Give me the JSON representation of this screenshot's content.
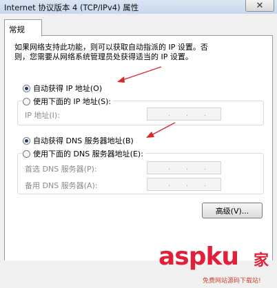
{
  "window": {
    "title": "Internet 协议版本 4 (TCP/IPv4) 属性"
  },
  "tabs": [
    {
      "label": "常规"
    }
  ],
  "description": {
    "line1": "如果网络支持此功能，则可以获取自动指派的 IP 设置。否",
    "line2": "则，您需要从网络系统管理员处获得适当的 IP 设置。"
  },
  "ip": {
    "auto_label": "自动获得 IP 地址(O)",
    "manual_label": "使用下面的 IP 地址(S):",
    "address_label": "IP 地址(I):"
  },
  "dns": {
    "auto_label": "自动获得 DNS 服务器地址(B)",
    "manual_label": "使用下面的 DNS 服务器地址(E):",
    "preferred_label": "首选 DNS 服务器(P):",
    "alternate_label": "备用 DNS 服务器(A):"
  },
  "buttons": {
    "advanced_label": "高级(V)..."
  },
  "watermark": {
    "logo_text": "aspku",
    "cn_text": "家",
    "sub_text": "免费网站源码下载站!"
  },
  "colors": {
    "arrow": "#d8282a",
    "selected_dot": "#243a6a"
  }
}
